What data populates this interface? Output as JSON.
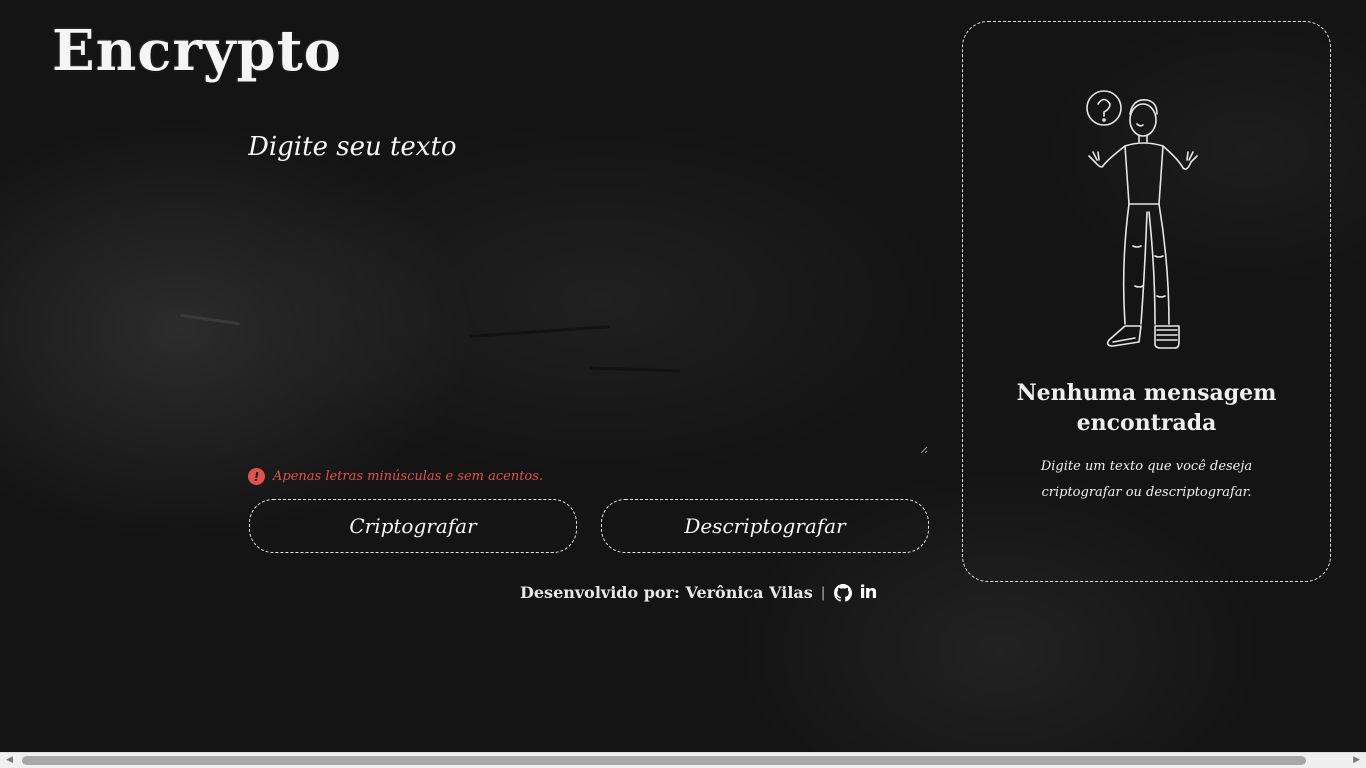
{
  "header": {
    "logo": "Encrypto"
  },
  "input": {
    "placeholder": "Digite seu texto",
    "value": ""
  },
  "hint": {
    "icon": "exclamation-circle-icon",
    "text": "Apenas letras minúsculas e sem acentos.",
    "color": "#e0524a"
  },
  "actions": {
    "encrypt_label": "Criptografar",
    "decrypt_label": "Descriptografar"
  },
  "footer": {
    "credit": "Desenvolvido por: Verônica Vilas",
    "separator": "|",
    "links": [
      {
        "icon": "github-icon"
      },
      {
        "icon": "linkedin-icon",
        "glyph": "in"
      }
    ]
  },
  "output": {
    "illustration": "confused-person-illustration",
    "title": "Nenhuma mensagem encontrada",
    "description": "Digite um texto que você deseja criptografar ou descriptografar."
  },
  "colors": {
    "background": "#141414",
    "chalk": "#f5f5f5",
    "error": "#e0524a"
  }
}
